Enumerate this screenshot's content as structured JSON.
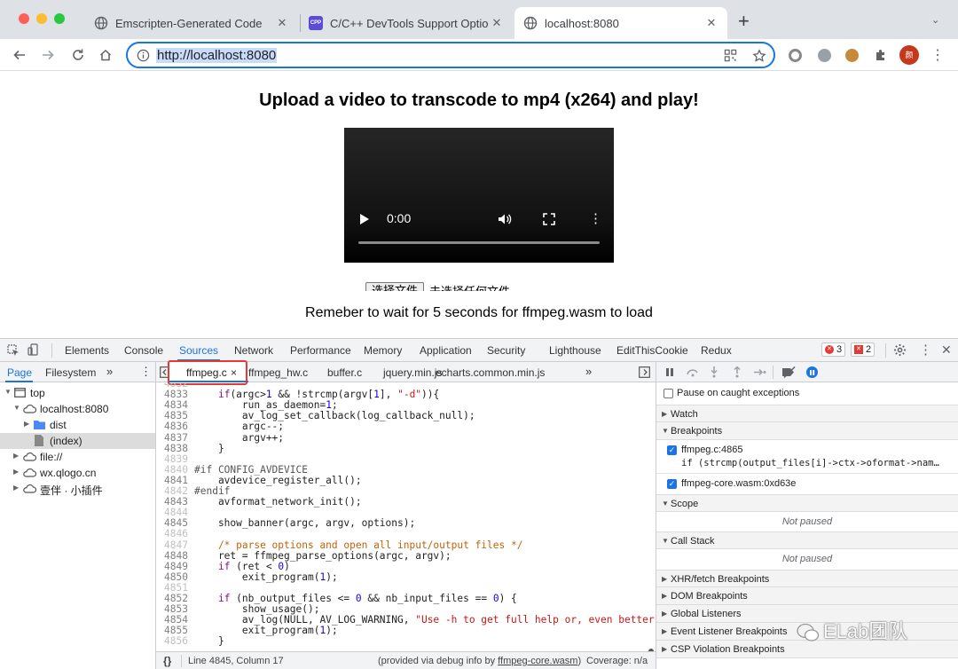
{
  "browser": {
    "tabs": [
      {
        "title": "Emscripten-Generated Code",
        "icon": "globe-icon"
      },
      {
        "title": "C/C++ DevTools Support Optio",
        "icon": "cpp-icon",
        "icon_text": "CPP"
      },
      {
        "title": "localhost:8080",
        "icon": "globe-icon"
      }
    ],
    "new_tab": "+",
    "url": "http://localhost:8080",
    "profile_initial": "颜",
    "colors": {
      "accent": "#1a73e8",
      "close": "#ff5f57",
      "min": "#febc2e",
      "max": "#28c840"
    }
  },
  "page": {
    "heading": "Upload a video to transcode to mp4 (x264) and play!",
    "video_time": "0:00",
    "file_button": "选择文件",
    "file_status": "未选择任何文件",
    "wait_text": "Remeber to wait for 5 seconds for ffmpeg.wasm to load"
  },
  "devtools": {
    "tabs": [
      "Elements",
      "Console",
      "Sources",
      "Network",
      "Performance",
      "Memory",
      "Application",
      "Security",
      "Lighthouse",
      "EditThisCookie",
      "Redux"
    ],
    "active_tab": "Sources",
    "errors": "3",
    "warnings": "2",
    "navigator": {
      "tabs": [
        "Page",
        "Filesystem"
      ],
      "more": "»",
      "tree": [
        {
          "label": "top",
          "arrow": "▼",
          "icon": "frame-icon"
        },
        {
          "label": "localhost:8080",
          "arrow": "▼",
          "icon": "cloud-icon"
        },
        {
          "label": "dist",
          "arrow": "▶",
          "icon": "folder-icon"
        },
        {
          "label": "(index)",
          "arrow": "",
          "icon": "file-icon"
        },
        {
          "label": "file://",
          "arrow": "▶",
          "icon": "cloud-icon"
        },
        {
          "label": "wx.qlogo.cn",
          "arrow": "▶",
          "icon": "cloud-icon"
        },
        {
          "label": "壹伴 · 小插件",
          "arrow": "▶",
          "icon": "cloud-icon"
        }
      ]
    },
    "editor": {
      "files": [
        "ffmpeg.c",
        "ffmpeg_hw.c",
        "buffer.c",
        "jquery.min.js",
        "echarts.common.min.js"
      ],
      "active_close": "×",
      "more": "»",
      "code": [
        {
          "n": "4832",
          "t": ""
        },
        {
          "n": "4833",
          "t": "    if(argc>1 && !strcmp(argv[1], \"-d\")){"
        },
        {
          "n": "4834",
          "t": "        run_as_daemon=1;"
        },
        {
          "n": "4835",
          "t": "        av_log_set_callback(log_callback_null);"
        },
        {
          "n": "4836",
          "t": "        argc--;"
        },
        {
          "n": "4837",
          "t": "        argv++;"
        },
        {
          "n": "4838",
          "t": "    }"
        },
        {
          "n": "4839",
          "t": ""
        },
        {
          "n": "4840",
          "t": "#if CONFIG_AVDEVICE"
        },
        {
          "n": "4841",
          "t": "    avdevice_register_all();"
        },
        {
          "n": "4842",
          "t": "#endif"
        },
        {
          "n": "4843",
          "t": "    avformat_network_init();"
        },
        {
          "n": "4844",
          "t": ""
        },
        {
          "n": "4845",
          "t": "    show_banner(argc, argv, options);"
        },
        {
          "n": "4846",
          "t": ""
        },
        {
          "n": "4847",
          "t": "    /* parse options and open all input/output files */"
        },
        {
          "n": "4848",
          "t": "    ret = ffmpeg_parse_options(argc, argv);"
        },
        {
          "n": "4849",
          "t": "    if (ret < 0)"
        },
        {
          "n": "4850",
          "t": "        exit_program(1);"
        },
        {
          "n": "4851",
          "t": ""
        },
        {
          "n": "4852",
          "t": "    if (nb_output_files <= 0 && nb_input_files == 0) {"
        },
        {
          "n": "4853",
          "t": "        show_usage();"
        },
        {
          "n": "4854",
          "t": "        av_log(NULL, AV_LOG_WARNING, \"Use -h to get full help or, even better,"
        },
        {
          "n": "4855",
          "t": "        exit_program(1);"
        },
        {
          "n": "4856",
          "t": "    }"
        }
      ],
      "status_braces": "{}",
      "status_position": "Line 4845, Column 17",
      "status_info_prefix": "(provided via debug info by ",
      "status_info_link": "ffmpeg-core.wasm",
      "status_info_suffix": ")",
      "coverage": "Coverage: n/a"
    },
    "debugger": {
      "pause_caught": "Pause on caught exceptions",
      "sections": {
        "watch": "Watch",
        "breakpoints": "Breakpoints",
        "scope": "Scope",
        "call_stack": "Call Stack",
        "xhr": "XHR/fetch Breakpoints",
        "dom": "DOM Breakpoints",
        "global": "Global Listeners",
        "event": "Event Listener Breakpoints",
        "csp": "CSP Violation Breakpoints"
      },
      "breakpoints": [
        {
          "title": "ffmpeg.c:4865",
          "code": "if (strcmp(output_files[i]->ctx->oformat->nam…"
        },
        {
          "title": "ffmpeg-core.wasm:0xd63e",
          "code": ""
        }
      ],
      "not_paused": "Not paused"
    },
    "watermark": "ELab团队"
  }
}
